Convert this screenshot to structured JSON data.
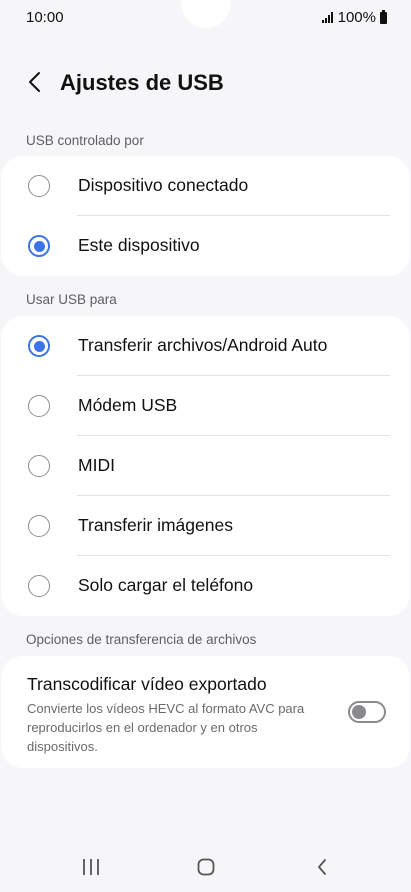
{
  "status_bar": {
    "time": "10:00",
    "battery": "100%",
    "signal_icon": "signal-icon",
    "battery_icon": "battery-icon"
  },
  "header": {
    "back_icon": "back-icon",
    "title": "Ajustes de USB"
  },
  "usb_controlled_by": {
    "label": "USB controlado por",
    "options": [
      {
        "label": "Dispositivo conectado",
        "selected": false
      },
      {
        "label": "Este dispositivo",
        "selected": true
      }
    ]
  },
  "use_usb_for": {
    "label": "Usar USB para",
    "options": [
      {
        "label": "Transferir archivos/Android Auto",
        "selected": true
      },
      {
        "label": "Módem USB",
        "selected": false
      },
      {
        "label": "MIDI",
        "selected": false
      },
      {
        "label": "Transferir imágenes",
        "selected": false
      },
      {
        "label": "Solo cargar el teléfono",
        "selected": false
      }
    ]
  },
  "file_transfer_options": {
    "label": "Opciones de transferencia de archivos",
    "transcode": {
      "title": "Transcodificar vídeo exportado",
      "description": "Convierte los vídeos HEVC al formato AVC para reproducirlos en el ordenador y en otros dispositivos.",
      "enabled": false
    }
  },
  "nav_bar": {
    "recents_icon": "recents-icon",
    "home_icon": "home-icon",
    "back_icon": "back-icon"
  },
  "colors": {
    "accent": "#3b74e6",
    "background": "#f6f6f8",
    "card": "#ffffff"
  }
}
